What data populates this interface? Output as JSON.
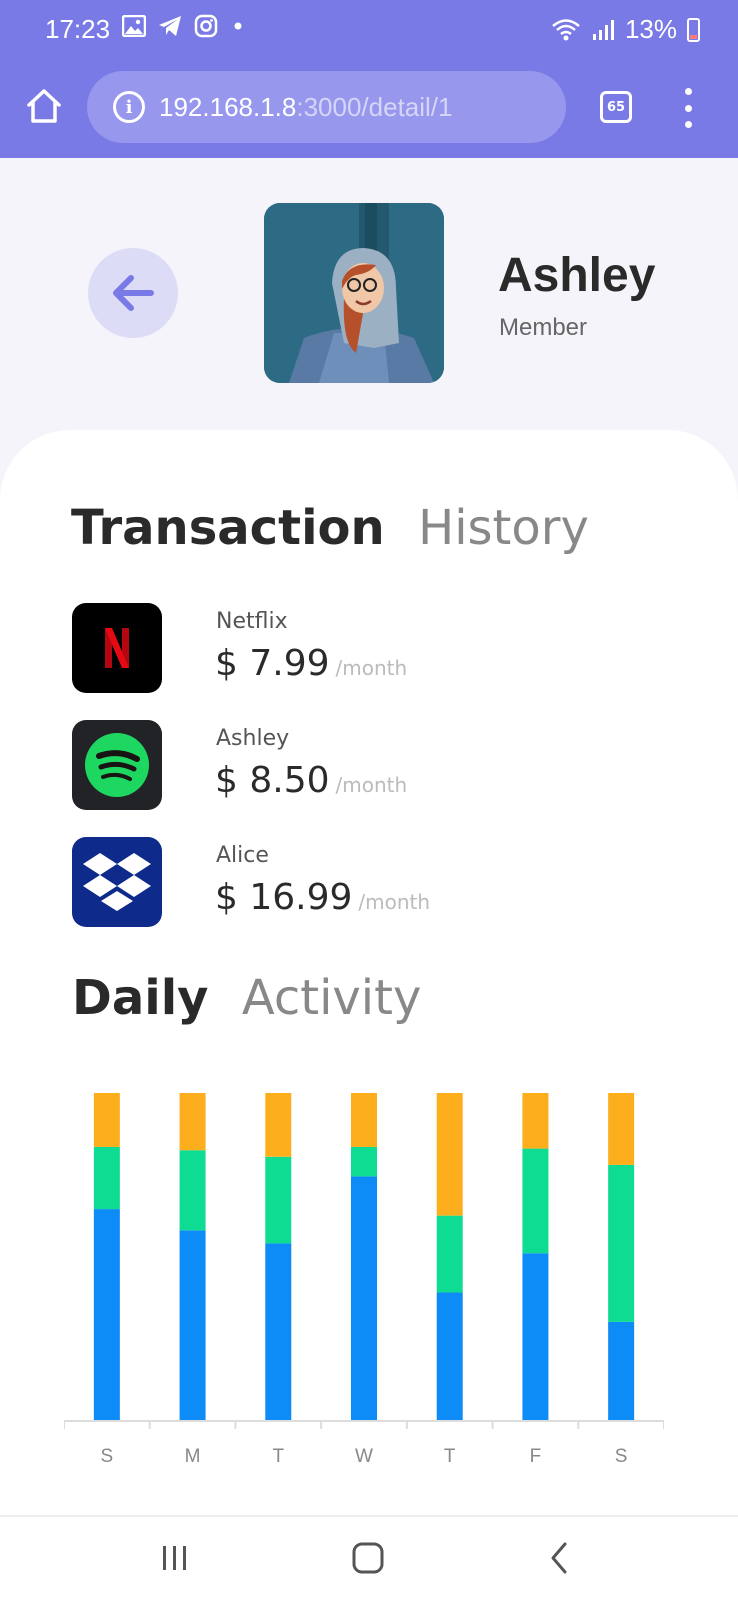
{
  "status_bar": {
    "time": "17:23",
    "battery": "13%",
    "icons": [
      "gallery-icon",
      "telegram-icon",
      "instagram-icon",
      "dot-icon",
      "wifi-icon",
      "signal-icon",
      "battery-icon"
    ]
  },
  "browser": {
    "url_host": "192.168.1.8",
    "url_path": ":3000/detail/1",
    "tab_count": "65"
  },
  "profile": {
    "name": "Ashley",
    "role": "Member"
  },
  "transactions": {
    "title_bold": "Transaction",
    "title_muted": "History",
    "items": [
      {
        "name": "Netflix",
        "price": "$ 7.99",
        "period": "/month",
        "icon": "netflix-icon",
        "bg": "#000000"
      },
      {
        "name": "Ashley",
        "price": "$ 8.50",
        "period": "/month",
        "icon": "spotify-icon",
        "bg": "#222326"
      },
      {
        "name": "Alice",
        "price": "$ 16.99",
        "period": "/month",
        "icon": "dropbox-icon",
        "bg": "#0e2a8a"
      }
    ]
  },
  "activity": {
    "title_bold": "Daily",
    "title_muted": "Activity"
  },
  "chart_data": {
    "type": "bar",
    "stacked": true,
    "categories": [
      "S",
      "M",
      "T",
      "W",
      "T",
      "F",
      "S"
    ],
    "series": [
      {
        "color": "#0d8cf7",
        "values": [
          64.5,
          58,
          54,
          74.5,
          39,
          51,
          30
        ]
      },
      {
        "color": "#0fdc93",
        "values": [
          19,
          24.5,
          26.5,
          9,
          23.5,
          32,
          48
        ]
      },
      {
        "color": "#fdae1d",
        "values": [
          16.5,
          17.5,
          19.5,
          16.5,
          37.5,
          17,
          22
        ]
      }
    ],
    "ylim": [
      0,
      100
    ],
    "grid": false
  }
}
